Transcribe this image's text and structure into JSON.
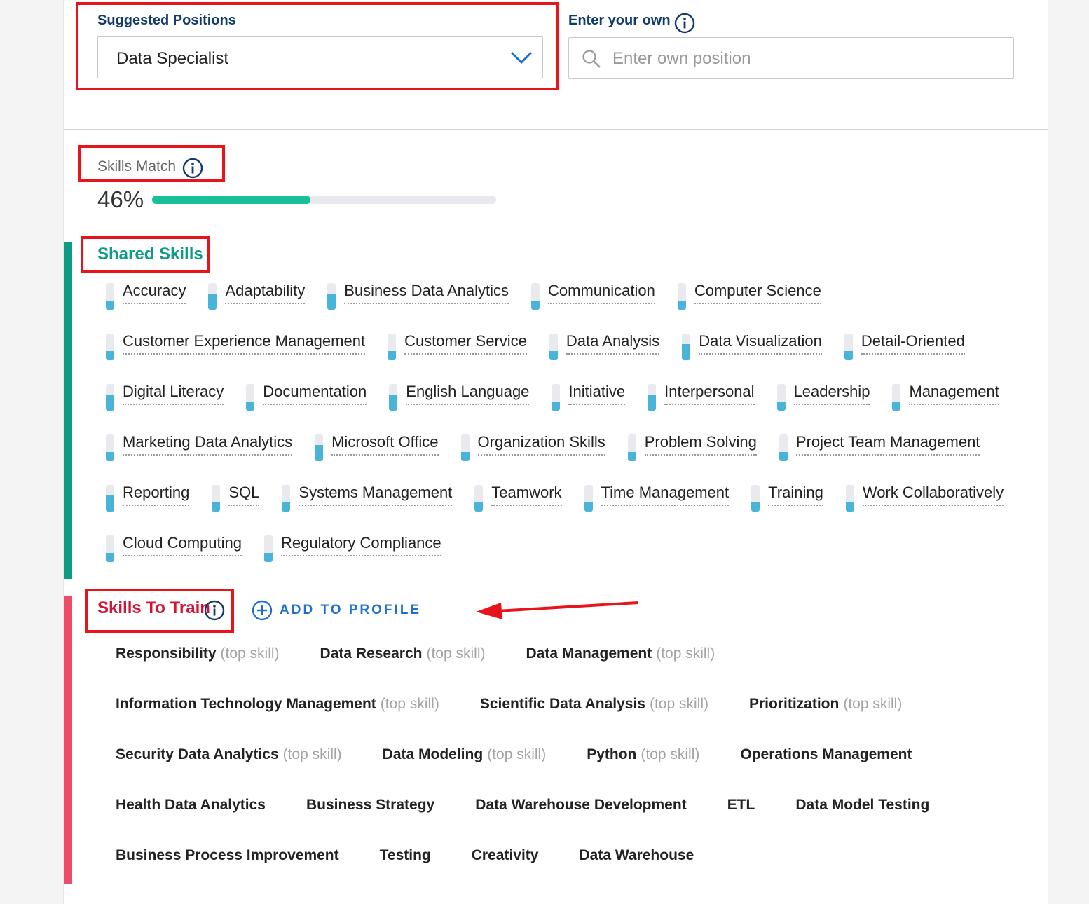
{
  "colors": {
    "accent_blue": "#123a6b",
    "shared_green": "#0e9b84",
    "train_red": "#cf1436",
    "progress_fill": "#16c09a",
    "meter_fill": "#4ab4d8",
    "annotation_red": "#e8141c",
    "link_blue": "#1f6fcf"
  },
  "position_picker": {
    "suggested_label": "Suggested Positions",
    "selected_value": "Data Specialist",
    "own_label": "Enter your own",
    "own_placeholder": "Enter own position"
  },
  "skills_match": {
    "label": "Skills Match",
    "percent_text": "46%",
    "percent_value": 0.46
  },
  "shared_skills": {
    "title": "Shared Skills",
    "items": [
      {
        "name": "Accuracy",
        "level": 0.34
      },
      {
        "name": "Adaptability",
        "level": 0.6
      },
      {
        "name": "Business Data Analytics",
        "level": 0.6
      },
      {
        "name": "Communication",
        "level": 0.34
      },
      {
        "name": "Computer Science",
        "level": 0.34
      },
      {
        "name": "Customer Experience Management",
        "level": 0.34
      },
      {
        "name": "Customer Service",
        "level": 0.34
      },
      {
        "name": "Data Analysis",
        "level": 0.34
      },
      {
        "name": "Data Visualization",
        "level": 0.6
      },
      {
        "name": "Detail-Oriented",
        "level": 0.34
      },
      {
        "name": "Digital Literacy",
        "level": 0.6
      },
      {
        "name": "Documentation",
        "level": 0.34
      },
      {
        "name": "English Language",
        "level": 0.6
      },
      {
        "name": "Initiative",
        "level": 0.34
      },
      {
        "name": "Interpersonal",
        "level": 0.6
      },
      {
        "name": "Leadership",
        "level": 0.34
      },
      {
        "name": "Management",
        "level": 0.34
      },
      {
        "name": "Marketing Data Analytics",
        "level": 0.34
      },
      {
        "name": "Microsoft Office",
        "level": 0.6
      },
      {
        "name": "Organization Skills",
        "level": 0.34
      },
      {
        "name": "Problem Solving",
        "level": 0.34
      },
      {
        "name": "Project Team Management",
        "level": 0.34
      },
      {
        "name": "Reporting",
        "level": 0.6
      },
      {
        "name": "SQL",
        "level": 0.34
      },
      {
        "name": "Systems Management",
        "level": 0.34
      },
      {
        "name": "Teamwork",
        "level": 0.34
      },
      {
        "name": "Time Management",
        "level": 0.34
      },
      {
        "name": "Training",
        "level": 0.34
      },
      {
        "name": "Work Collaboratively",
        "level": 0.34
      },
      {
        "name": "Cloud Computing",
        "level": 0.34
      },
      {
        "name": "Regulatory Compliance",
        "level": 0.34
      }
    ]
  },
  "skills_to_train": {
    "title": "Skills To Train",
    "add_button": "ADD TO PROFILE",
    "items": [
      {
        "name": "Responsibility",
        "tag": "(top skill)"
      },
      {
        "name": "Data Research",
        "tag": "(top skill)"
      },
      {
        "name": "Data Management",
        "tag": "(top skill)"
      },
      {
        "name": "Information Technology Management",
        "tag": "(top skill)"
      },
      {
        "name": "Scientific Data Analysis",
        "tag": "(top skill)"
      },
      {
        "name": "Prioritization",
        "tag": "(top skill)"
      },
      {
        "name": "Security Data Analytics",
        "tag": "(top skill)"
      },
      {
        "name": "Data Modeling",
        "tag": "(top skill)"
      },
      {
        "name": "Python",
        "tag": "(top skill)"
      },
      {
        "name": "Operations Management",
        "tag": ""
      },
      {
        "name": "Health Data Analytics",
        "tag": ""
      },
      {
        "name": "Business Strategy",
        "tag": ""
      },
      {
        "name": "Data Warehouse Development",
        "tag": ""
      },
      {
        "name": "ETL",
        "tag": ""
      },
      {
        "name": "Data Model Testing",
        "tag": ""
      },
      {
        "name": "Business Process Improvement",
        "tag": ""
      },
      {
        "name": "Testing",
        "tag": ""
      },
      {
        "name": "Creativity",
        "tag": ""
      },
      {
        "name": "Data Warehouse",
        "tag": ""
      }
    ]
  }
}
